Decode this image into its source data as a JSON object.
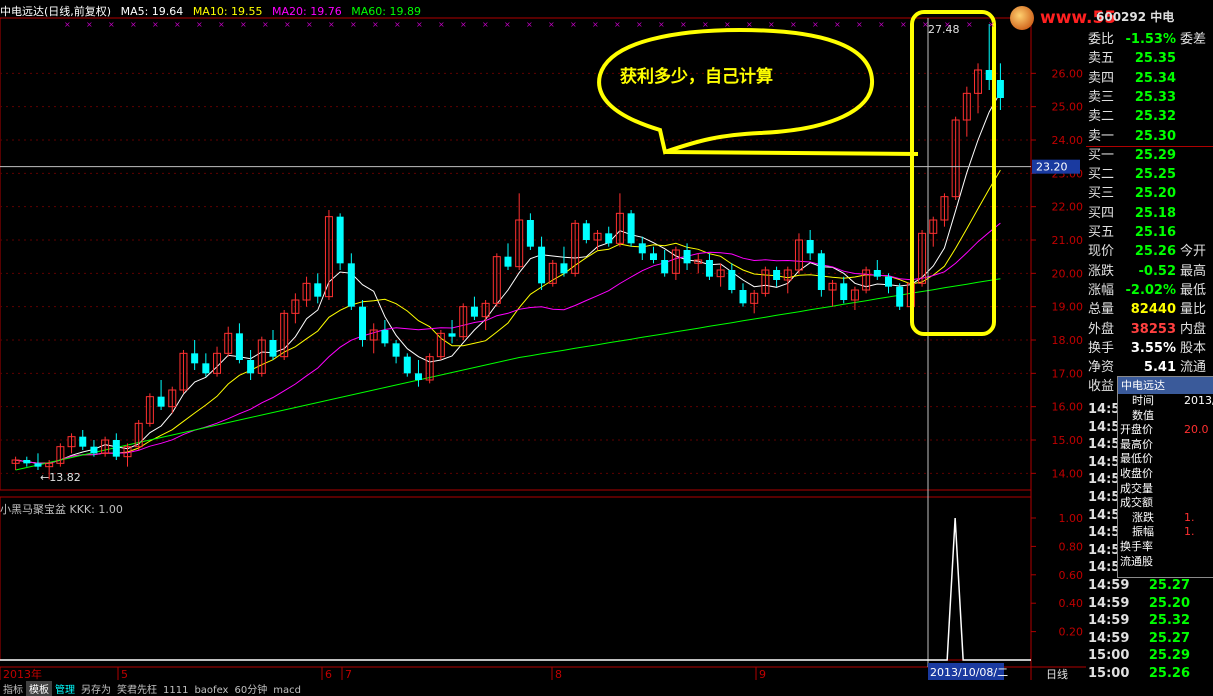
{
  "header": {
    "title": "中电远达(日线,前复权)",
    "ma5": "MA5: 19.64",
    "ma10": "MA10: 19.55",
    "ma20": "MA20: 19.76",
    "ma60": "MA60: 19.89",
    "colors": {
      "ma5": "#ffffff",
      "ma10": "#ffff00",
      "ma20": "#ff00ff",
      "ma60": "#00ff00"
    }
  },
  "annotation": {
    "bubble_text": "获利多少，自己计算",
    "high_label": "27.48",
    "low_label": "←13.82",
    "crosshair_price": "23.20",
    "box_color": "#ffff00"
  },
  "watermark": "www.55",
  "price_axis": [
    "26.00",
    "25.00",
    "24.00",
    "23.00",
    "22.00",
    "21.00",
    "20.00",
    "19.00",
    "18.00",
    "17.00",
    "16.00",
    "15.00",
    "14.00"
  ],
  "indicator": {
    "header": "小黑马聚宝盆  KKK: 1.00",
    "axis": [
      "1.00",
      "0.80",
      "0.60",
      "0.40",
      "0.20"
    ]
  },
  "date_axis": {
    "labels": [
      "2013年",
      "5",
      "6",
      "7",
      "8",
      "9"
    ],
    "crosshair_date": "2013/10/08/二",
    "period": "日线"
  },
  "bottom_tabs": [
    "指标",
    "模板",
    "管理",
    "另存为",
    "笑君先枉",
    "1111",
    "baofex",
    "60分钟",
    "macd"
  ],
  "right_panel": {
    "code_header": "600292  中电",
    "rows": [
      {
        "label": "委比",
        "value": "-1.53%",
        "trail": "委差",
        "color": "#00ff00"
      },
      {
        "label": "卖五",
        "value": "25.35",
        "trail": "",
        "color": "#00ff00"
      },
      {
        "label": "卖四",
        "value": "25.34",
        "trail": "",
        "color": "#00ff00"
      },
      {
        "label": "卖三",
        "value": "25.33",
        "trail": "",
        "color": "#00ff00"
      },
      {
        "label": "卖二",
        "value": "25.32",
        "trail": "",
        "color": "#00ff00"
      },
      {
        "label": "卖一",
        "value": "25.30",
        "trail": "",
        "color": "#00ff00"
      },
      {
        "label": "买一",
        "value": "25.29",
        "trail": "",
        "color": "#00ff00"
      },
      {
        "label": "买二",
        "value": "25.25",
        "trail": "",
        "color": "#00ff00"
      },
      {
        "label": "买三",
        "value": "25.20",
        "trail": "",
        "color": "#00ff00"
      },
      {
        "label": "买四",
        "value": "25.18",
        "trail": "",
        "color": "#00ff00"
      },
      {
        "label": "买五",
        "value": "25.16",
        "trail": "",
        "color": "#00ff00"
      },
      {
        "label": "现价",
        "value": "25.26",
        "trail": "今开",
        "color": "#00ff00"
      },
      {
        "label": "涨跌",
        "value": "-0.52",
        "trail": "最高",
        "color": "#00ff00"
      },
      {
        "label": "涨幅",
        "value": "-2.02%",
        "trail": "最低",
        "color": "#00ff00"
      },
      {
        "label": "总量",
        "value": "82440",
        "trail": "量比",
        "color": "#ffff00"
      },
      {
        "label": "外盘",
        "value": "38253",
        "trail": "内盘",
        "color": "#ff4040"
      },
      {
        "label": "换手",
        "value": "3.55%",
        "trail": "股本",
        "color": "#ffffff"
      },
      {
        "label": "净资",
        "value": "5.41",
        "trail": "流通",
        "color": "#ffffff"
      },
      {
        "label": "收益",
        "value": "",
        "trail": "",
        "color": "#ffffff"
      }
    ],
    "ticks": [
      {
        "time": "14:5",
        "price": ""
      },
      {
        "time": "14:5",
        "price": ""
      },
      {
        "time": "14:5",
        "price": ""
      },
      {
        "time": "14:5",
        "price": ""
      },
      {
        "time": "14:5",
        "price": ""
      },
      {
        "time": "14:5",
        "price": ""
      },
      {
        "time": "14:5",
        "price": ""
      },
      {
        "time": "14:5",
        "price": ""
      },
      {
        "time": "14:5",
        "price": ""
      },
      {
        "time": "14:5",
        "price": ""
      },
      {
        "time": "14:59",
        "price": "25.27"
      },
      {
        "time": "14:59",
        "price": "25.20"
      },
      {
        "time": "14:59",
        "price": "25.32"
      },
      {
        "time": "14:59",
        "price": "25.27"
      },
      {
        "time": "15:00",
        "price": "25.29"
      },
      {
        "time": "15:00",
        "price": "25.26"
      }
    ]
  },
  "popup": {
    "title": "中电远达",
    "rows": [
      {
        "label": "时间",
        "value": "2013/"
      },
      {
        "label": "数值",
        "value": ""
      },
      {
        "label": "开盘价",
        "value": "20.0"
      },
      {
        "label": "最高价",
        "value": ""
      },
      {
        "label": "最低价",
        "value": ""
      },
      {
        "label": "收盘价",
        "value": ""
      },
      {
        "label": "成交量",
        "value": ""
      },
      {
        "label": "成交额",
        "value": ""
      },
      {
        "label": "涨跌",
        "value": "1."
      },
      {
        "label": "振幅",
        "value": "1."
      },
      {
        "label": "换手率",
        "value": ""
      },
      {
        "label": "流通股",
        "value": ""
      }
    ]
  },
  "chart_data": {
    "type": "candlestick",
    "ylim": [
      13.5,
      27.6
    ],
    "candles": [
      [
        14.3,
        14.5,
        14.1,
        14.4
      ],
      [
        14.4,
        14.5,
        14.2,
        14.3
      ],
      [
        14.3,
        14.6,
        14.1,
        14.2
      ],
      [
        14.2,
        14.4,
        13.82,
        14.3
      ],
      [
        14.3,
        14.9,
        14.2,
        14.8
      ],
      [
        14.8,
        15.2,
        14.6,
        15.1
      ],
      [
        15.1,
        15.3,
        14.7,
        14.8
      ],
      [
        14.8,
        15.0,
        14.5,
        14.6
      ],
      [
        14.6,
        15.1,
        14.5,
        15.0
      ],
      [
        15.0,
        15.2,
        14.4,
        14.5
      ],
      [
        14.5,
        14.9,
        14.2,
        14.8
      ],
      [
        14.8,
        15.6,
        14.7,
        15.5
      ],
      [
        15.5,
        16.4,
        15.4,
        16.3
      ],
      [
        16.3,
        16.8,
        15.9,
        16.0
      ],
      [
        16.0,
        16.6,
        15.8,
        16.5
      ],
      [
        16.5,
        17.7,
        16.4,
        17.6
      ],
      [
        17.6,
        18.0,
        17.1,
        17.3
      ],
      [
        17.3,
        17.6,
        16.9,
        17.0
      ],
      [
        17.0,
        17.8,
        16.9,
        17.6
      ],
      [
        17.6,
        18.4,
        17.5,
        18.2
      ],
      [
        18.2,
        18.5,
        17.3,
        17.4
      ],
      [
        17.4,
        17.7,
        16.8,
        17.0
      ],
      [
        17.0,
        18.1,
        16.9,
        18.0
      ],
      [
        18.0,
        18.3,
        17.4,
        17.5
      ],
      [
        17.5,
        18.9,
        17.4,
        18.8
      ],
      [
        18.8,
        19.4,
        18.5,
        19.2
      ],
      [
        19.2,
        19.9,
        19.0,
        19.7
      ],
      [
        19.7,
        20.0,
        19.1,
        19.3
      ],
      [
        19.3,
        21.9,
        19.2,
        21.7
      ],
      [
        21.7,
        21.8,
        20.1,
        20.3
      ],
      [
        20.3,
        20.6,
        18.9,
        19.0
      ],
      [
        19.0,
        19.2,
        17.8,
        18.0
      ],
      [
        18.0,
        18.5,
        17.6,
        18.3
      ],
      [
        18.3,
        18.6,
        17.8,
        17.9
      ],
      [
        17.9,
        18.0,
        17.3,
        17.5
      ],
      [
        17.5,
        17.6,
        16.9,
        17.0
      ],
      [
        17.0,
        17.4,
        16.6,
        16.8
      ],
      [
        16.8,
        17.6,
        16.7,
        17.5
      ],
      [
        17.5,
        18.3,
        17.4,
        18.2
      ],
      [
        18.2,
        18.6,
        17.9,
        18.1
      ],
      [
        18.1,
        19.1,
        18.0,
        19.0
      ],
      [
        19.0,
        19.3,
        18.6,
        18.7
      ],
      [
        18.7,
        19.2,
        18.3,
        19.1
      ],
      [
        19.1,
        20.6,
        19.0,
        20.5
      ],
      [
        20.5,
        20.9,
        20.1,
        20.2
      ],
      [
        20.2,
        22.4,
        20.1,
        21.6
      ],
      [
        21.6,
        21.8,
        20.7,
        20.8
      ],
      [
        20.8,
        21.1,
        19.5,
        19.7
      ],
      [
        19.7,
        20.4,
        19.6,
        20.3
      ],
      [
        20.3,
        20.8,
        19.9,
        20.0
      ],
      [
        20.0,
        21.6,
        19.9,
        21.5
      ],
      [
        21.5,
        21.6,
        20.9,
        21.0
      ],
      [
        21.0,
        21.3,
        20.7,
        21.2
      ],
      [
        21.2,
        21.4,
        20.8,
        20.9
      ],
      [
        20.9,
        22.4,
        20.8,
        21.8
      ],
      [
        21.8,
        21.9,
        20.8,
        20.9
      ],
      [
        20.9,
        21.1,
        20.4,
        20.6
      ],
      [
        20.6,
        20.8,
        20.3,
        20.4
      ],
      [
        20.4,
        20.7,
        19.9,
        20.0
      ],
      [
        20.0,
        20.8,
        19.8,
        20.7
      ],
      [
        20.7,
        20.9,
        20.1,
        20.3
      ],
      [
        20.3,
        20.6,
        20.0,
        20.4
      ],
      [
        20.4,
        20.6,
        19.8,
        19.9
      ],
      [
        19.9,
        20.3,
        19.6,
        20.1
      ],
      [
        20.1,
        20.3,
        19.4,
        19.5
      ],
      [
        19.5,
        19.7,
        19.0,
        19.1
      ],
      [
        19.1,
        19.5,
        18.8,
        19.4
      ],
      [
        19.4,
        20.2,
        19.3,
        20.1
      ],
      [
        20.1,
        20.2,
        19.6,
        19.8
      ],
      [
        19.8,
        20.2,
        19.4,
        20.1
      ],
      [
        20.1,
        21.2,
        20.0,
        21.0
      ],
      [
        21.0,
        21.3,
        20.4,
        20.6
      ],
      [
        20.6,
        20.7,
        19.3,
        19.5
      ],
      [
        19.5,
        19.8,
        19.0,
        19.7
      ],
      [
        19.7,
        19.9,
        19.1,
        19.2
      ],
      [
        19.2,
        19.6,
        18.9,
        19.5
      ],
      [
        19.5,
        20.2,
        19.4,
        20.1
      ],
      [
        20.1,
        20.4,
        19.8,
        19.9
      ],
      [
        19.9,
        20.0,
        19.4,
        19.6
      ],
      [
        19.6,
        19.7,
        18.9,
        19.0
      ],
      [
        19.0,
        19.8,
        18.9,
        19.7
      ],
      [
        19.7,
        21.3,
        19.6,
        21.2
      ],
      [
        21.2,
        21.7,
        20.8,
        21.6
      ],
      [
        21.6,
        22.4,
        21.4,
        22.3
      ],
      [
        22.3,
        24.7,
        22.2,
        24.6
      ],
      [
        24.6,
        25.6,
        24.1,
        25.4
      ],
      [
        25.4,
        26.3,
        24.8,
        26.1
      ],
      [
        26.1,
        27.48,
        25.5,
        25.8
      ],
      [
        25.8,
        26.3,
        24.9,
        25.26
      ]
    ],
    "indicator_signal": {
      "x_index": 84,
      "value": 1.0
    }
  }
}
